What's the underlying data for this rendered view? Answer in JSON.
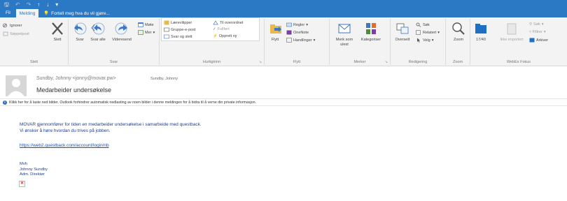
{
  "quick_access": {
    "save": "🖫",
    "undo": "↶",
    "redo": "↷",
    "up": "↑",
    "down": "↓",
    "more": "▾"
  },
  "tabs": {
    "file": "Fil",
    "active": "Melding"
  },
  "tell_me": "Fortell meg hva du vil gjøre...",
  "ribbon": {
    "slett": {
      "ignorer": "Ignorer",
      "soppelpost": "Søppelpost",
      "slett": "Slett",
      "label": "Slett"
    },
    "svar": {
      "svar": "Svar",
      "svar_alle": "Svar alle",
      "videresend": "Videresend",
      "mote": "Møte",
      "mer": "Mer",
      "label": "Svar"
    },
    "hurtigtrinn": {
      "item1": "Lærevilipper",
      "item2": "Til overordnet",
      "item3": "Gruppe-e-post",
      "item4": "Fullført",
      "item5": "Svar og slett",
      "item6": "Opprett ny",
      "label": "Hurtigtrinn"
    },
    "flytt": {
      "flytt": "Flytt",
      "regler": "Regler",
      "onenote": "OneNote",
      "handlinger": "Handlinger",
      "label": "Flytt"
    },
    "merker": {
      "merk_som_ulest": "Merk som ulest",
      "kategoriser": "Kategoriser",
      "label": "Merker"
    },
    "redigering": {
      "oversett": "Oversett",
      "sok": "Søk",
      "relatert": "Relatert",
      "velg": "Velg",
      "label": "Redigering"
    },
    "zoom": {
      "zoom": "Zoom",
      "label": "Zoom"
    },
    "webex": {
      "count": "17/40",
      "ikke_importert": "Ikke importert",
      "sok": "Søk",
      "filtrer": "Filtrer",
      "arkiver": "Arkiver",
      "label": "WebEx Fokus"
    }
  },
  "message": {
    "from": "Sundby, Johnny <jonny@movar.pw>",
    "to": "Sundby, Johnny",
    "subject": "Medarbeider undersøkelse",
    "infobar": "Klikk her for å laste ned bilder. Outlook forhindrer automatisk nedlasting av noen bilder i denne meldingen for å bidra til å verne din private informasjon.",
    "body_line1": "MOVAR gjennomfører for tiden en medarbeider undersøkelse i samarbeide med questback.",
    "body_line2": "Vi ønsker å høre hvordan du trives på jobben.",
    "link": "https://web2.questback.com/account/login/nb",
    "sig1": "Mvh",
    "sig2": "Johnny Sundby",
    "sig3": "Adm. Direktør"
  },
  "colors": {
    "brand": "#2b78c5",
    "ribbon": "#f3f3f3",
    "body_text": "#1f3f8f",
    "link": "#1e4fb0"
  }
}
